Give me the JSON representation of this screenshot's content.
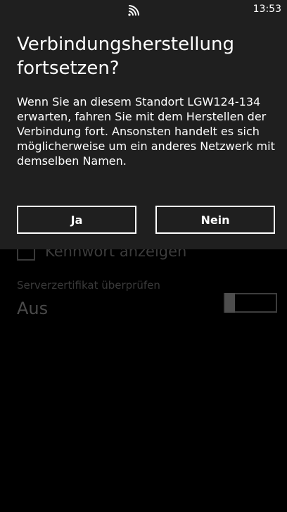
{
  "status_bar": {
    "signal_icon": "wifi-signal-icon",
    "time": "13:53"
  },
  "dialog": {
    "title": "Verbindungsherstellung fortsetzen?",
    "message": "Wenn Sie an diesem Standort LGW124-134 erwarten, fahren Sie mit dem Herstellen der Verbindung fort. Ansonsten handelt es sich möglicherweise um ein anderes Netzwerk mit demselben Namen.",
    "yes_label": "Ja",
    "no_label": "Nein"
  },
  "settings": {
    "show_password_label": "Kennwort anzeigen",
    "show_password_checked": false,
    "cert_label": "Serverzertifikat überprüfen",
    "cert_value": "Aus",
    "cert_toggle_on": false
  },
  "colors": {
    "dialog_background": "#1f1f1f",
    "page_background": "#000000",
    "text": "#ffffff"
  }
}
